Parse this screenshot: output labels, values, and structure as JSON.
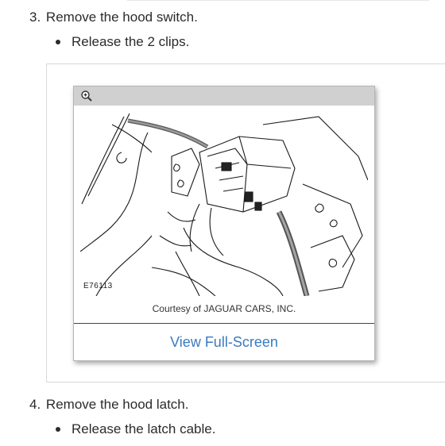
{
  "steps": [
    {
      "number": "3.",
      "text": "Remove the hood switch.",
      "bullets": [
        "Release the 2 clips."
      ]
    },
    {
      "number": "4.",
      "text": "Remove the hood latch.",
      "bullets": [
        "Release the latch cable."
      ]
    }
  ],
  "figure": {
    "code": "E76113",
    "caption": "Courtesy of JAGUAR CARS, INC.",
    "fullscreen_label": "View Full-Screen",
    "zoom_icon": "zoom-in-icon"
  },
  "colors": {
    "link": "#3a7bbf",
    "text": "#2b2b2b",
    "card_header": "#d0d0d0"
  }
}
